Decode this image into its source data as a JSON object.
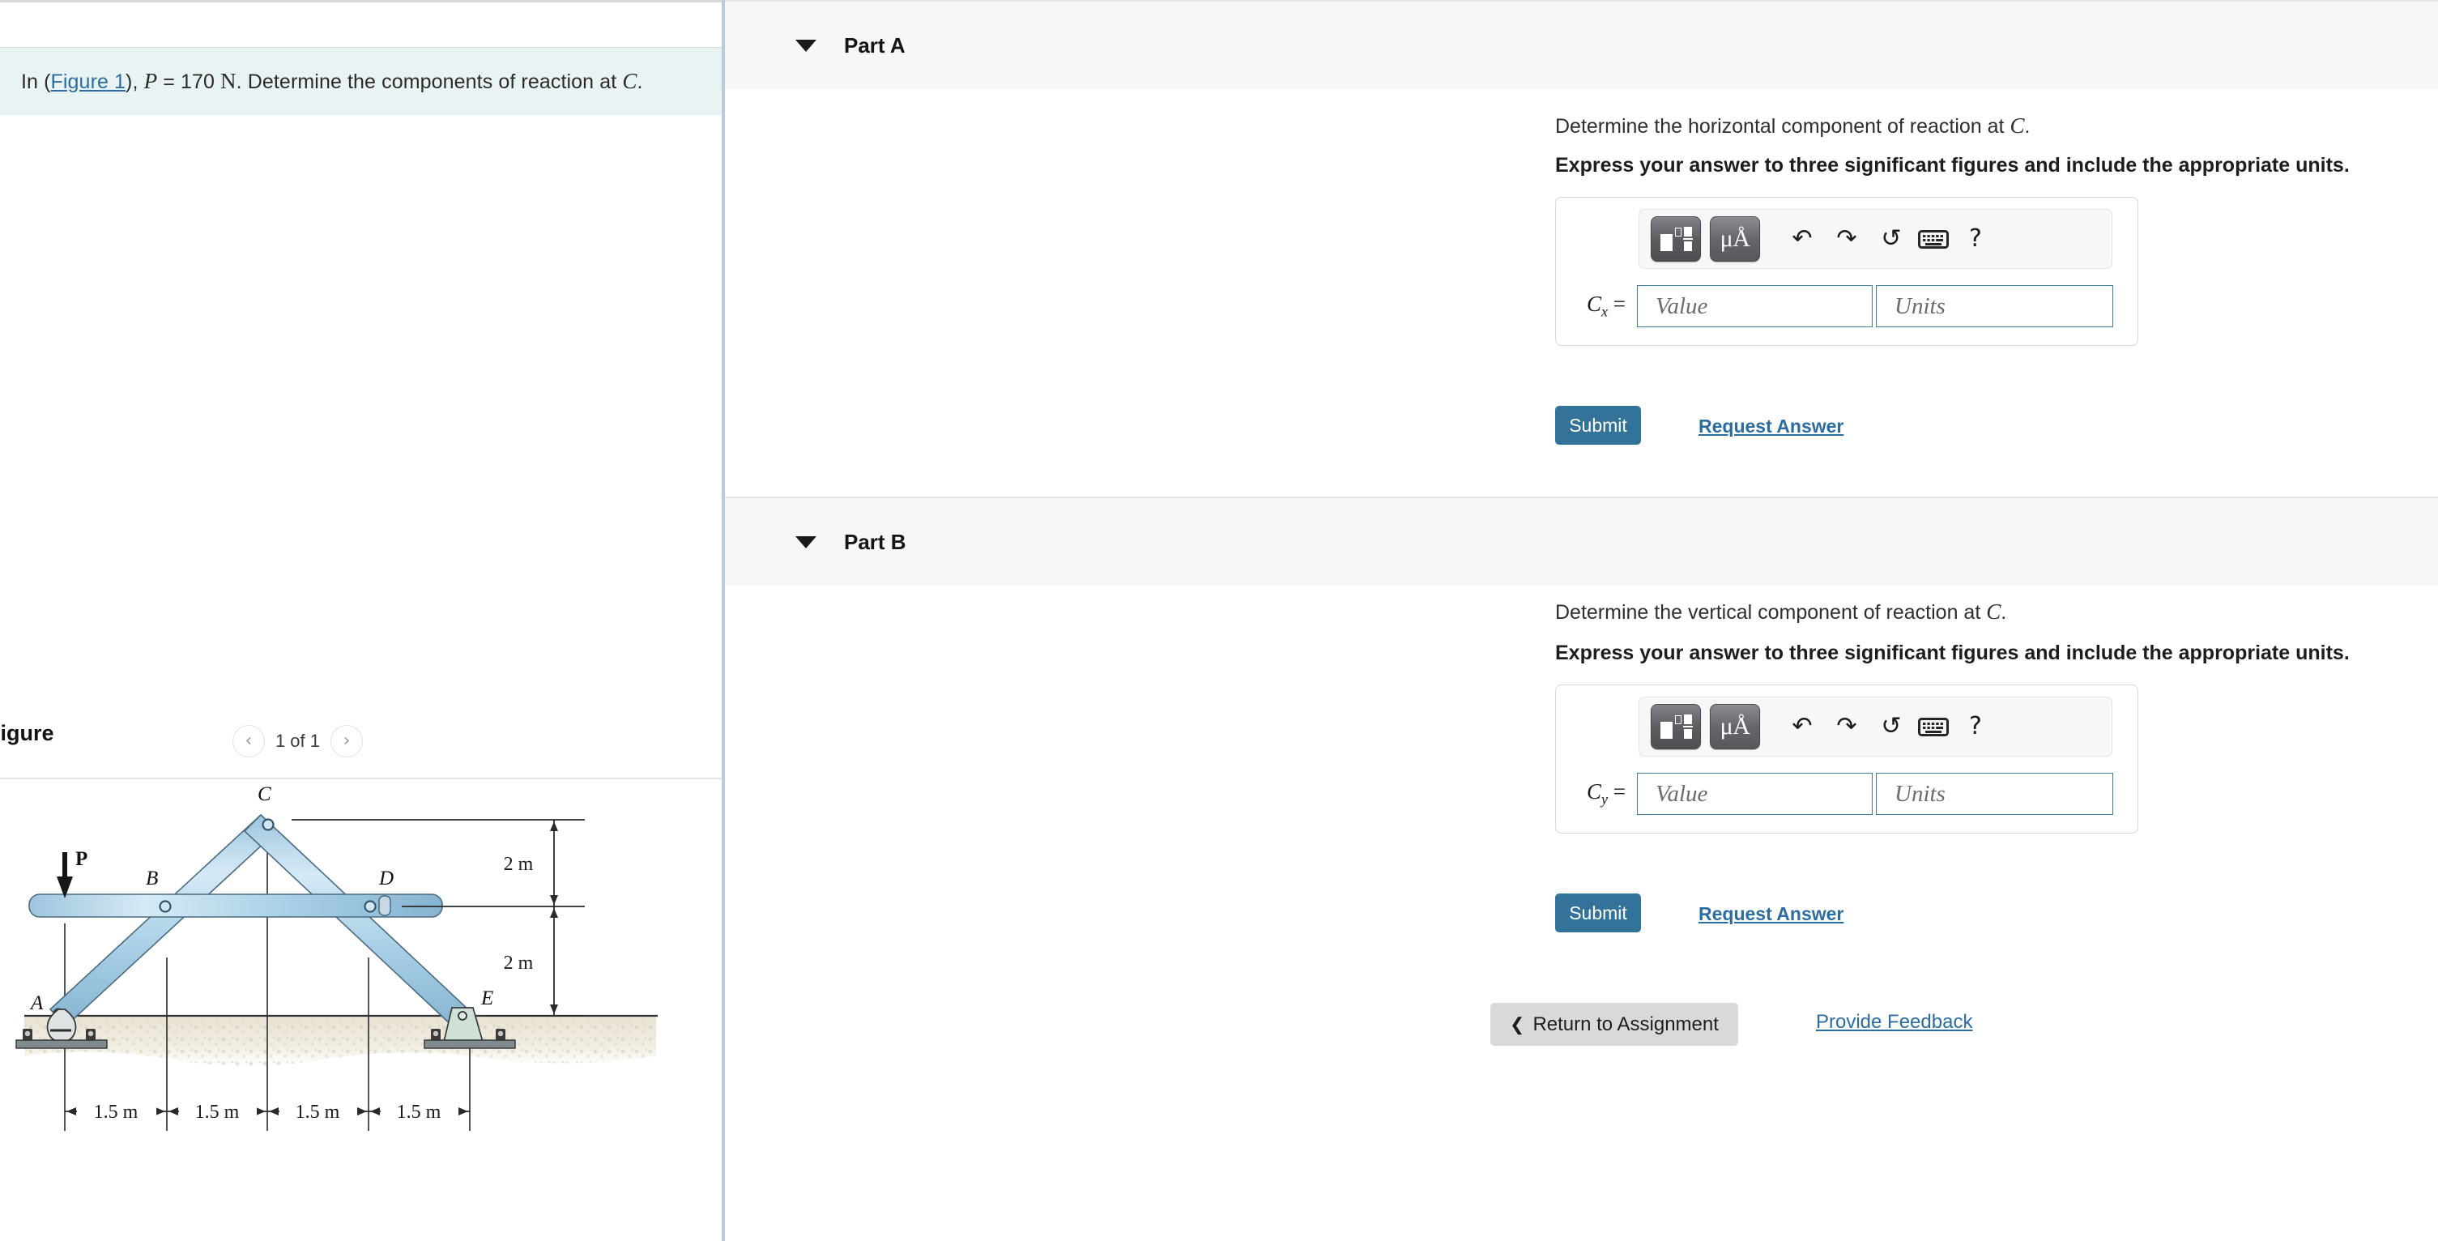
{
  "question": {
    "prefix": "In (",
    "figure_link": "Figure 1",
    "middle": "), ",
    "var_p": "P",
    "equals": " = 170 ",
    "unit_n": "N",
    "suffix": ". Determine the components of reaction at ",
    "var_c": "C",
    "period": "."
  },
  "figure_panel": {
    "title": "Figure",
    "prev_icon": "chevron-left-icon",
    "count": "1 of 1",
    "next_icon": "chevron-right-icon"
  },
  "figure": {
    "load_label": "P",
    "nodes": {
      "a": "A",
      "b": "B",
      "c": "C",
      "d": "D",
      "e": "E"
    },
    "vertical_dims": [
      "2 m",
      "2 m"
    ],
    "horizontal_dims": [
      "1.5 m",
      "1.5 m",
      "1.5 m",
      "1.5 m"
    ]
  },
  "toolbar": {
    "template_icon": "math-template-icon",
    "units_icon": "micro-angstrom-units-icon",
    "undo_icon": "undo-arrow-icon",
    "redo_icon": "redo-arrow-icon",
    "reset_icon": "reset-circular-arrow-icon",
    "keyboard_icon": "keyboard-icon",
    "help_icon": "?",
    "undo_glyph": "↶",
    "redo_glyph": "↷",
    "reset_glyph": "↺",
    "units_label": "μÅ"
  },
  "parts": [
    {
      "id": "A",
      "header": "Part A",
      "prompt_pre": "Determine the horizontal component of reaction at ",
      "prompt_var": "C",
      "prompt_post": ".",
      "instruction": "Express your answer to three significant figures and include the appropriate units.",
      "answer_var_base": "C",
      "answer_var_sub": "x",
      "answer_equals": "=",
      "value_placeholder": "Value",
      "units_placeholder": "Units",
      "value_text": "",
      "units_text": "",
      "submit_label": "Submit",
      "request_label": "Request Answer"
    },
    {
      "id": "B",
      "header": "Part B",
      "prompt_pre": "Determine the vertical component of reaction at ",
      "prompt_var": "C",
      "prompt_post": ".",
      "instruction": "Express your answer to three significant figures and include the appropriate units.",
      "answer_var_base": "C",
      "answer_var_sub": "y",
      "answer_equals": "=",
      "value_placeholder": "Value",
      "units_placeholder": "Units",
      "value_text": "",
      "units_text": "",
      "submit_label": "Submit",
      "request_label": "Request Answer"
    }
  ],
  "footer": {
    "return_icon": "chevron-left-icon",
    "return_label": "Return to Assignment",
    "feedback_label": "Provide Feedback"
  },
  "colors": {
    "accent": "#337299",
    "link": "#2b6ca3",
    "question_bg": "#e9f3f4",
    "part_header_bg": "#f7f7f7",
    "divider": "#b9ccdd",
    "input_border": "#3d7b9c",
    "member_fill": "#aacfe4"
  }
}
